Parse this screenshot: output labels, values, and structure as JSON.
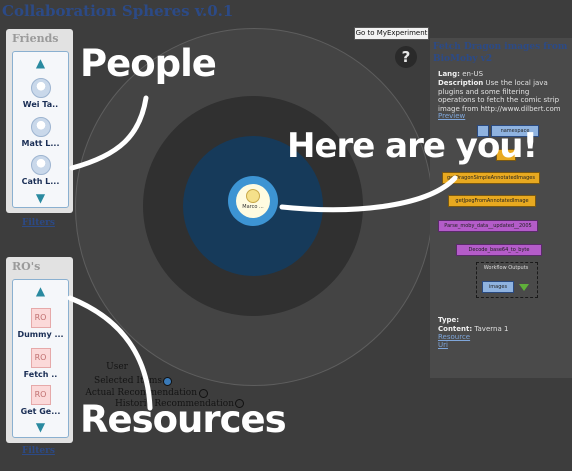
{
  "app": {
    "title": "Collaboration Spheres v.0.1"
  },
  "friends_panel": {
    "heading": "Friends",
    "items": [
      {
        "label": "Wei Ta.."
      },
      {
        "label": "Matt L..."
      },
      {
        "label": "Cath L..."
      }
    ],
    "filters_label": "Filters"
  },
  "ros_panel": {
    "heading": "RO's",
    "items": [
      {
        "label": "Dummy ...",
        "icon": "RO"
      },
      {
        "label": "Fetch ..",
        "icon": "RO"
      },
      {
        "label": "Get Ge...",
        "icon": "RO"
      }
    ],
    "filters_label": "Filters"
  },
  "spheres": {
    "center_label": "Marco ..."
  },
  "toolbar": {
    "experiment_button": "Go to MyExperiment",
    "help_icon": "question-mark-icon"
  },
  "detail": {
    "title": "Fetch Dragon images from BioMoby v2",
    "lang_label": "Lang:",
    "lang_value": "en-US",
    "description_label": "Description",
    "description_text": "Use the local java plugins and some filtering operations to fetch the comic strip image from http://www.dilbert.com",
    "preview_link": "Preview",
    "workflow": {
      "node1": "namespace",
      "node3": "getDragonSimpleAnnotatedImages",
      "node4": "getJpegFromAnnotatedImage",
      "node5": "Parse_moby_data__updated__2005",
      "node6": "Decode_base64_to_byte",
      "outputs_label": "Workflow Outputs",
      "output_item": "images"
    },
    "type_label": "Type:",
    "content_label": "Content:",
    "content_value": "Taverna 1",
    "resource_link": "Resource",
    "uri_link": "Uri"
  },
  "legend": {
    "user": "User",
    "selected": "Selected Items",
    "actual": "Actual Recommendation",
    "historic": "Historic Recommendation"
  },
  "annotations": {
    "people": "People",
    "you": "Here are you!",
    "resources": "Resources"
  }
}
